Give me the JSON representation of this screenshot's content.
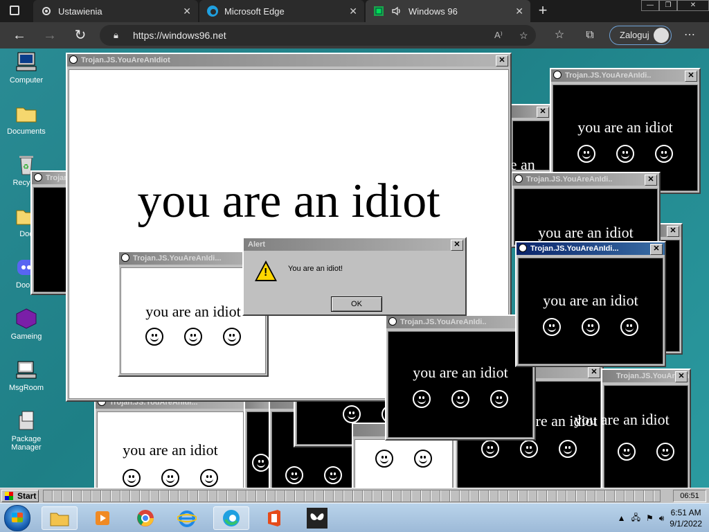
{
  "browser": {
    "tabs": [
      {
        "label": "Ustawienia"
      },
      {
        "label": "Microsoft Edge"
      },
      {
        "label": "Windows 96"
      }
    ],
    "url": "https://windows96.net",
    "login_label": "Zaloguj"
  },
  "desktop_icons": [
    {
      "label": "Computer"
    },
    {
      "label": "Documents"
    },
    {
      "label": "Recycle"
    },
    {
      "label": "Doc"
    },
    {
      "label": "Doore"
    },
    {
      "label": "Gameing"
    },
    {
      "label": "MsgRoom"
    },
    {
      "label": "Package Manager"
    }
  ],
  "virus": {
    "window_title": "Trojan.JS.YouAreAnIdiot",
    "window_title_short": "Trojan.JS.YouAreAnIdi...",
    "window_title_faded": "Trojan.JS.YouAreAnIdi..",
    "message": "you are an idiot",
    "close_glyph": "✕"
  },
  "alert": {
    "title": "Alert",
    "message": "You are an idiot!",
    "ok_label": "OK"
  },
  "win96_taskbar": {
    "start_label": "Start",
    "clock": "06:51"
  },
  "win7_taskbar": {
    "time": "6:51 AM",
    "date": "9/1/2022"
  },
  "colors": {
    "desktop": "#1f8a8a",
    "win95_face": "#c0c0c0",
    "title_inactive": "#808080",
    "title_active": "#0a246a"
  }
}
